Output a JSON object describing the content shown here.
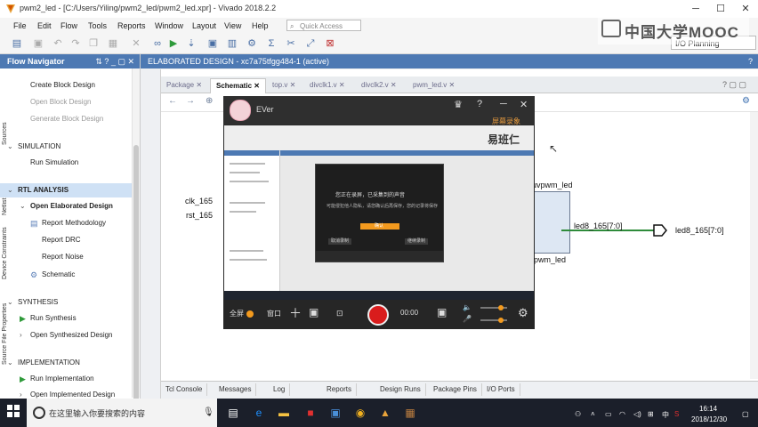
{
  "window": {
    "title": "pwm2_led - [C:/Users/Yiling/pwm2_led/pwm2_led.xpr] - Vivado 2018.2.2"
  },
  "menu": [
    "File",
    "Edit",
    "Flow",
    "Tools",
    "Reports",
    "Window",
    "Layout",
    "View",
    "Help"
  ],
  "quick_access": {
    "placeholder": "Quick Access"
  },
  "layout_select": {
    "value": "I/O Planning"
  },
  "watermark": {
    "text": "中国大学MOOC"
  },
  "flow_navigator": {
    "title": "Flow Navigator",
    "items": [
      {
        "label": "Create Block Design"
      },
      {
        "label": "Open Block Design"
      },
      {
        "label": "Generate Block Design"
      },
      {
        "label": "SIMULATION"
      },
      {
        "label": "Run Simulation"
      },
      {
        "label": "RTL ANALYSIS"
      },
      {
        "label": "Open Elaborated Design"
      },
      {
        "label": "Report Methodology"
      },
      {
        "label": "Report DRC"
      },
      {
        "label": "Report Noise"
      },
      {
        "label": "Schematic"
      },
      {
        "label": "SYNTHESIS"
      },
      {
        "label": "Run Synthesis"
      },
      {
        "label": "Open Synthesized Design"
      },
      {
        "label": "IMPLEMENTATION"
      },
      {
        "label": "Run Implementation"
      },
      {
        "label": "Open Implemented Design"
      }
    ]
  },
  "design_header": {
    "title": "ELABORATED DESIGN",
    "part": "xc7a75tfgg484-1",
    "status": "(active)",
    "help": "?"
  },
  "side_tabs": [
    "Sources",
    "Netlist",
    "Device Constraints",
    "Source File Properties"
  ],
  "editor_tabs": [
    "Package",
    "Schematic",
    "top.v",
    "divclk1.v",
    "divclk2.v",
    "pwm_led.v"
  ],
  "schematic": {
    "inputs": [
      "clk_165",
      "rst_165"
    ],
    "module_name": "uvpwm_led",
    "module_type": "pwm_led",
    "net": "led8_165[7:0]",
    "output": "led8_165[7:0]"
  },
  "bottom_tabs": [
    "Tcl Console",
    "Messages",
    "Log",
    "Reports",
    "Design Runs",
    "Package Pins",
    "I/O Ports"
  ],
  "recorder": {
    "user": "EVer",
    "caption": "屏幕录象",
    "logo": "易班仁",
    "dialog": {
      "line1": "您正在录屏，已采集到的声音",
      "line2": "可能侵犯他人隐私，请您确认后再保存，您的记录将保存",
      "confirm": "确认",
      "left_btn": "取消录制",
      "right_btn": "继续录制"
    },
    "bottom": {
      "full": "全屏",
      "window": "窗口",
      "timer": "00:00"
    }
  },
  "taskbar": {
    "search_placeholder": "在这里输入你要搜索的内容",
    "tray_lang": "中",
    "time": "16:14",
    "date": "2018/12/30"
  }
}
